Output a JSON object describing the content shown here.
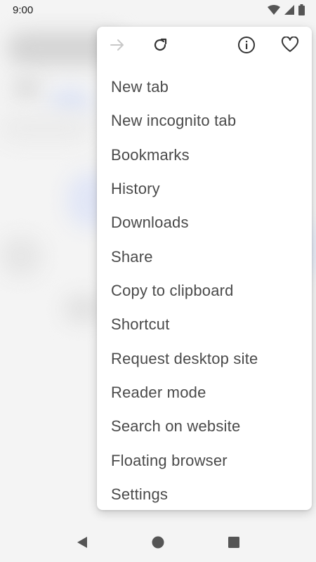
{
  "status_bar": {
    "time": "9:00"
  },
  "toolbar": {
    "icons": [
      "forward-icon",
      "reload-icon",
      "night-mode-icon",
      "info-icon",
      "favorite-icon"
    ]
  },
  "menu": {
    "items": [
      "New tab",
      "New incognito tab",
      "Bookmarks",
      "History",
      "Downloads",
      "Share",
      "Copy to clipboard",
      "Shortcut",
      "Request desktop site",
      "Reader mode",
      "Search on website",
      "Floating browser",
      "Settings"
    ]
  },
  "colors": {
    "menu_text": "#4a4a4a",
    "icon_active": "#333333",
    "icon_disabled": "#c8c8c8"
  }
}
